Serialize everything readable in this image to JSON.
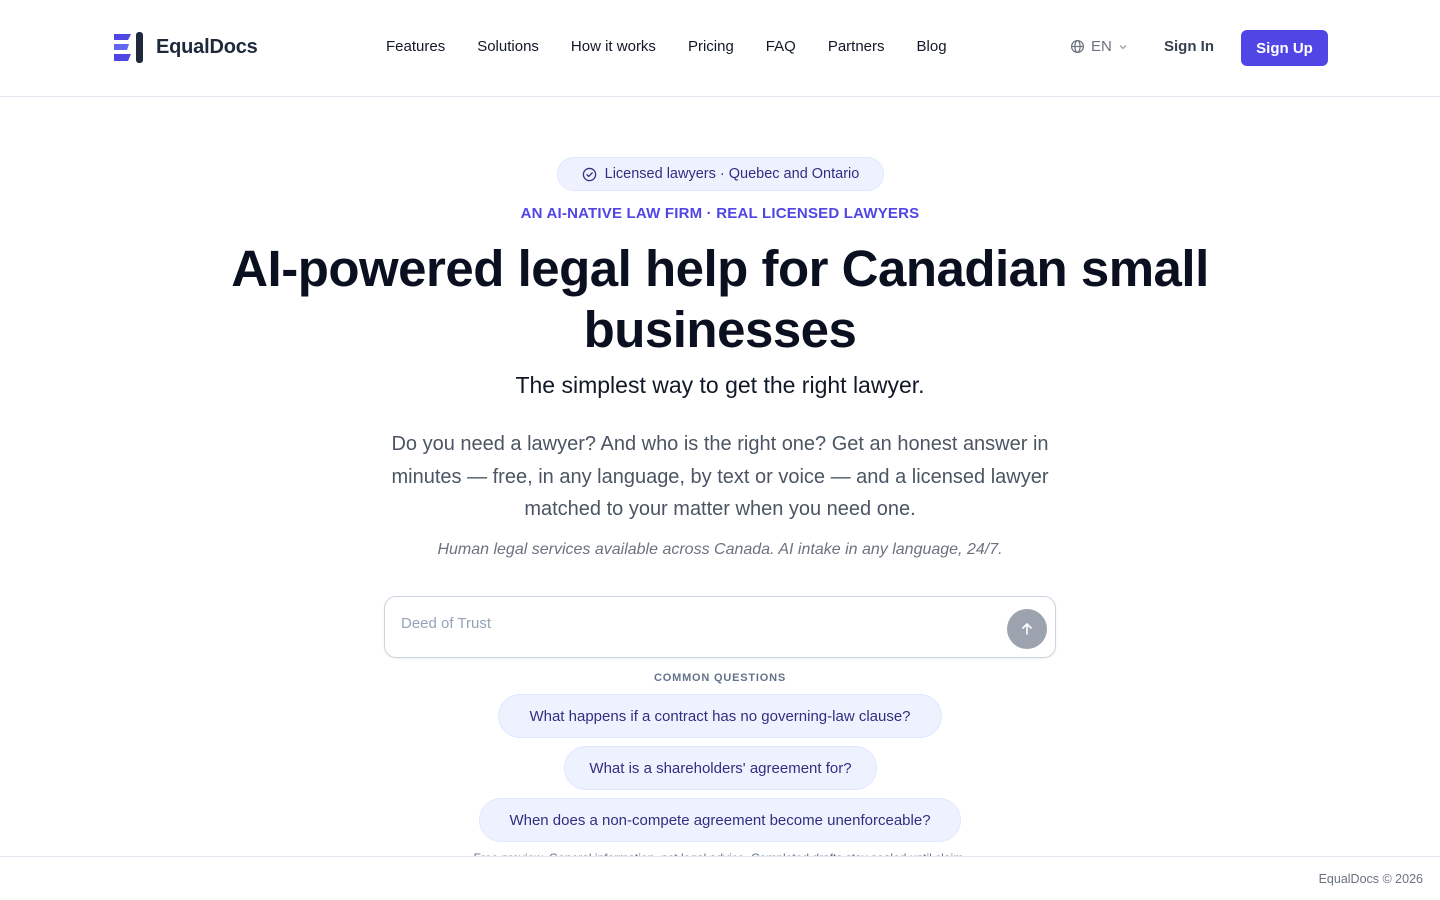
{
  "brand": {
    "name": "EqualDocs",
    "accent_color": "#4f46e5"
  },
  "nav": {
    "items": [
      {
        "label": "Features"
      },
      {
        "label": "Solutions"
      },
      {
        "label": "How it works"
      },
      {
        "label": "Pricing"
      },
      {
        "label": "FAQ"
      },
      {
        "label": "Partners"
      },
      {
        "label": "Blog"
      }
    ],
    "language": "EN",
    "language_icon": "globe-icon",
    "sign_in": "Sign In",
    "sign_up": "Sign Up"
  },
  "hero": {
    "badge": "Licensed lawyers · Quebec and Ontario",
    "badge_icon": "check-circle-icon",
    "eyebrow": "AN AI-NATIVE LAW FIRM · REAL LICENSED LAWYERS",
    "title": "AI-powered legal help for Canadian small businesses",
    "subtitle": "The simplest way to get the right lawyer.",
    "lead": "Do you need a lawyer? And who is the right one? Get an honest answer in minutes — free, in any language, by text or voice — and a licensed lawyer matched to your matter when you need one.",
    "note": "Human legal services available across Canada. AI intake in any language, 24/7."
  },
  "search": {
    "placeholder": "Deed of Trust",
    "value": "",
    "send_icon": "arrow-up-icon"
  },
  "common_questions": {
    "label": "COMMON QUESTIONS",
    "items": [
      {
        "label": "What happens if a contract has no governing-law clause?"
      },
      {
        "label": "What is a shareholders' agreement for?"
      },
      {
        "label": "When does a non-compete agreement become unenforceable?"
      }
    ]
  },
  "disclaimer": "Free preview. General information, not legal advice. Completed drafts stay sealed until claim.",
  "footer": {
    "copyright": "EqualDocs © 2026"
  }
}
